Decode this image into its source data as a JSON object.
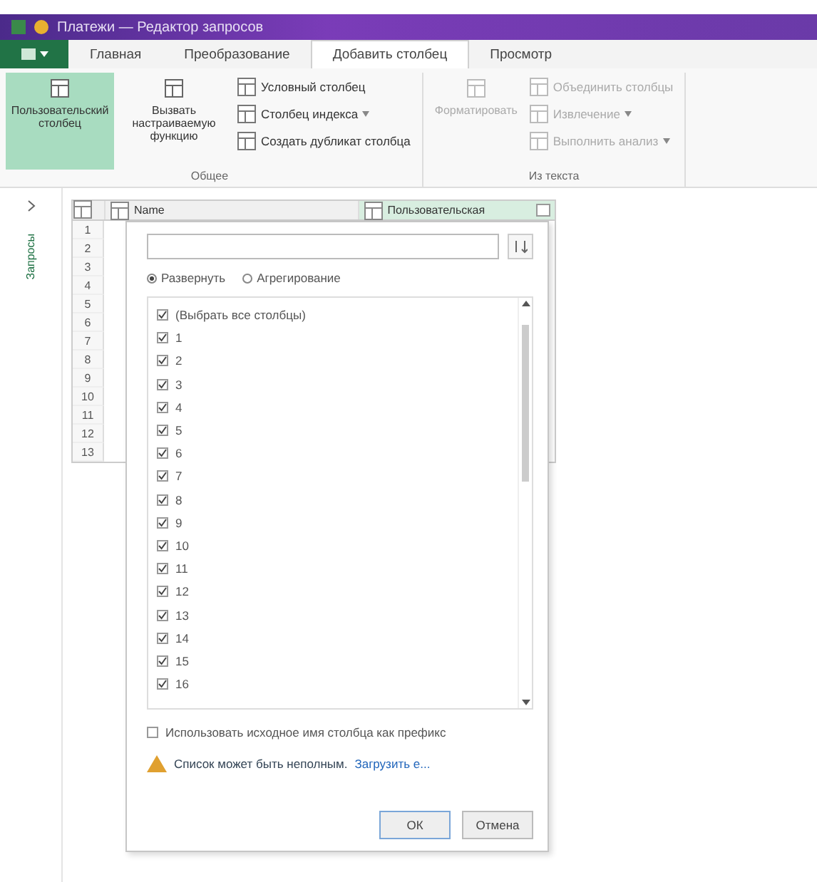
{
  "window": {
    "title": "Платежи — Редактор запросов"
  },
  "tabs": [
    {
      "label": "Главная",
      "selected": false
    },
    {
      "label": "Преобразование",
      "selected": false
    },
    {
      "label": "Добавить столбец",
      "selected": true
    },
    {
      "label": "Просмотр",
      "selected": false
    }
  ],
  "ribbon": {
    "groups": [
      {
        "label": "Общее",
        "items": [
          {
            "kind": "large",
            "label": "Пользовательский столбец",
            "selected": true,
            "disabled": false
          },
          {
            "kind": "large",
            "label": "Вызвать настраиваемую функцию",
            "selected": false,
            "disabled": false
          },
          {
            "kind": "stack",
            "items": [
              {
                "label": "Условный столбец",
                "disabled": false,
                "caret": false
              },
              {
                "label": "Столбец индекса",
                "disabled": false,
                "caret": true
              },
              {
                "label": "Создать дубликат столбца",
                "disabled": false,
                "caret": false
              }
            ]
          }
        ]
      },
      {
        "label": "Из текста",
        "items": [
          {
            "kind": "large",
            "label": "Форматировать",
            "selected": false,
            "disabled": true
          },
          {
            "kind": "stack",
            "items": [
              {
                "label": "Объединить столбцы",
                "disabled": true,
                "caret": false
              },
              {
                "label": "Извлечение",
                "disabled": true,
                "caret": true
              },
              {
                "label": "Выполнить анализ",
                "disabled": true,
                "caret": true
              }
            ]
          }
        ]
      }
    ]
  },
  "queries_pane": {
    "label": "Запросы"
  },
  "table": {
    "columns": [
      {
        "label": "Name"
      },
      {
        "label": "Пользовательская"
      }
    ],
    "row_numbers": [
      "1",
      "2",
      "3",
      "4",
      "5",
      "6",
      "7",
      "8",
      "9",
      "10",
      "11",
      "12",
      "13"
    ]
  },
  "popup": {
    "modes": [
      {
        "label": "Развернуть",
        "selected": true
      },
      {
        "label": "Агрегирование",
        "selected": false
      }
    ],
    "columns": [
      {
        "label": "(Выбрать все столбцы)",
        "checked": true
      },
      {
        "label": "1",
        "checked": true
      },
      {
        "label": "2",
        "checked": true
      },
      {
        "label": "3",
        "checked": true
      },
      {
        "label": "4",
        "checked": true
      },
      {
        "label": "5",
        "checked": true
      },
      {
        "label": "6",
        "checked": true
      },
      {
        "label": "7",
        "checked": true
      },
      {
        "label": "8",
        "checked": true
      },
      {
        "label": "9",
        "checked": true
      },
      {
        "label": "10",
        "checked": true
      },
      {
        "label": "11",
        "checked": true
      },
      {
        "label": "12",
        "checked": true
      },
      {
        "label": "13",
        "checked": true
      },
      {
        "label": "14",
        "checked": true
      },
      {
        "label": "15",
        "checked": true
      },
      {
        "label": "16",
        "checked": true
      }
    ],
    "prefix": {
      "label": "Использовать исходное имя столбца как префикс",
      "checked": false
    },
    "warning": {
      "text": "Список может быть неполным.",
      "link": "Загрузить е..."
    },
    "buttons": [
      {
        "label": "ОК",
        "kind": "primary"
      },
      {
        "label": "Отмена",
        "kind": "secondary"
      }
    ]
  }
}
